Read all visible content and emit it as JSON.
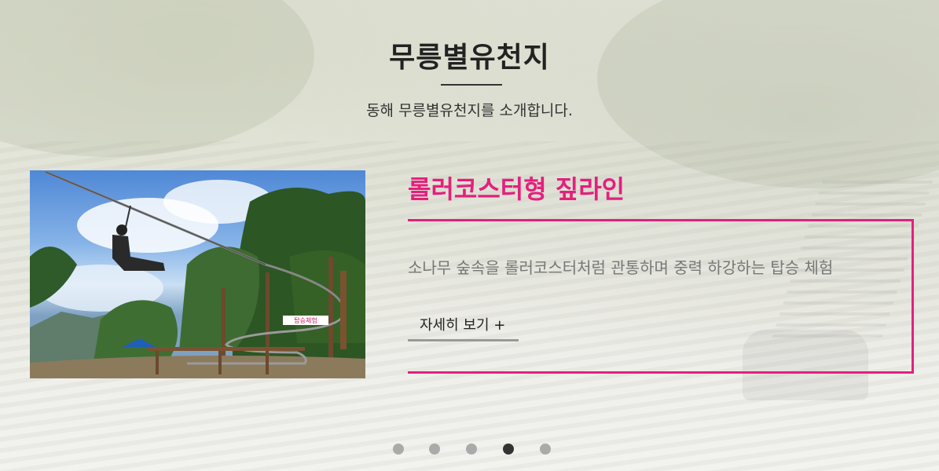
{
  "header": {
    "title": "무릉별유천지",
    "subtitle": "동해 무릉별유천지를 소개합니다."
  },
  "slide": {
    "title": "롤러코스터형 짚라인",
    "description": "소나무 숲속을 롤러코스터처럼 관통하며 중력 하강하는 탑승 체험",
    "more_label": "자세히 보기 +",
    "photo_sign_text": "탑승체험"
  },
  "pagination": {
    "total": 5,
    "active_index": 3
  },
  "colors": {
    "accent": "#e4207d",
    "title": "#222222",
    "description": "#777777",
    "dot_inactive": "#aaaaaa",
    "dot_active": "#333333"
  }
}
